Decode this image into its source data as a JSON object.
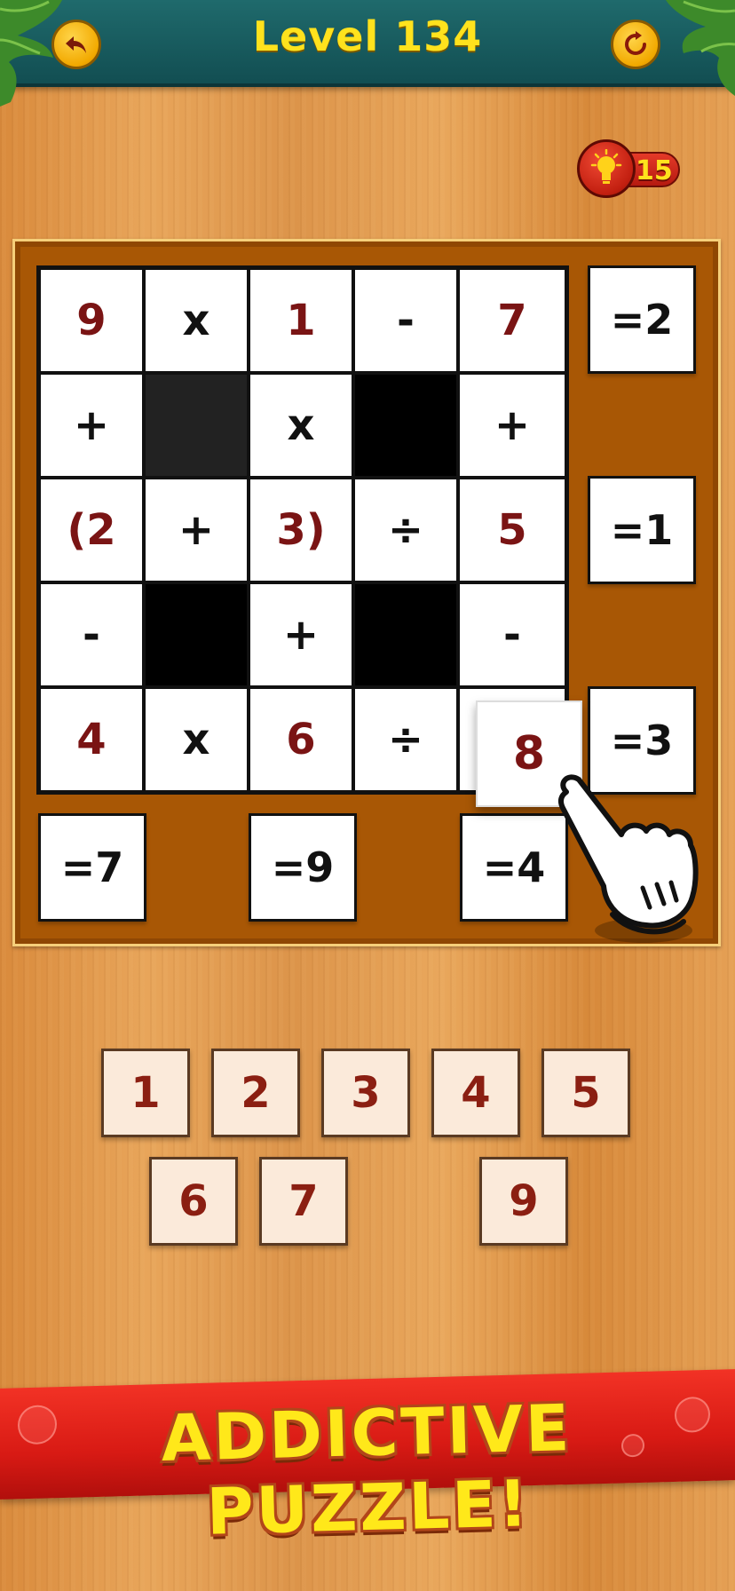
{
  "header": {
    "title": "Level 134",
    "back_icon": "back-arrow-icon",
    "restart_icon": "restart-icon"
  },
  "hint": {
    "icon": "lightbulb-icon",
    "count": "15"
  },
  "grid": {
    "rows": [
      [
        "9",
        "x",
        "1",
        "-",
        "7"
      ],
      [
        "+",
        "",
        "x",
        "",
        "+"
      ],
      [
        "(2",
        "+",
        "3)",
        "÷",
        "5"
      ],
      [
        "-",
        "",
        "+",
        "",
        "-"
      ],
      [
        "4",
        "x",
        "6",
        "÷",
        ""
      ]
    ],
    "row_results": [
      "=2",
      "=1",
      "=3"
    ],
    "col_results": [
      "=7",
      "=9",
      "=4"
    ]
  },
  "dragged_tile": "8",
  "number_tray": [
    "1",
    "2",
    "3",
    "4",
    "5",
    "6",
    "7",
    "9"
  ],
  "banner": {
    "text": "ADDICTIVE PUZZLE!"
  },
  "colors": {
    "header_bg": "#1f6a6c",
    "title_yellow": "#ffe21d",
    "number_red": "#7a1414",
    "board_brown": "#a85705",
    "banner_red": "#e02019"
  }
}
